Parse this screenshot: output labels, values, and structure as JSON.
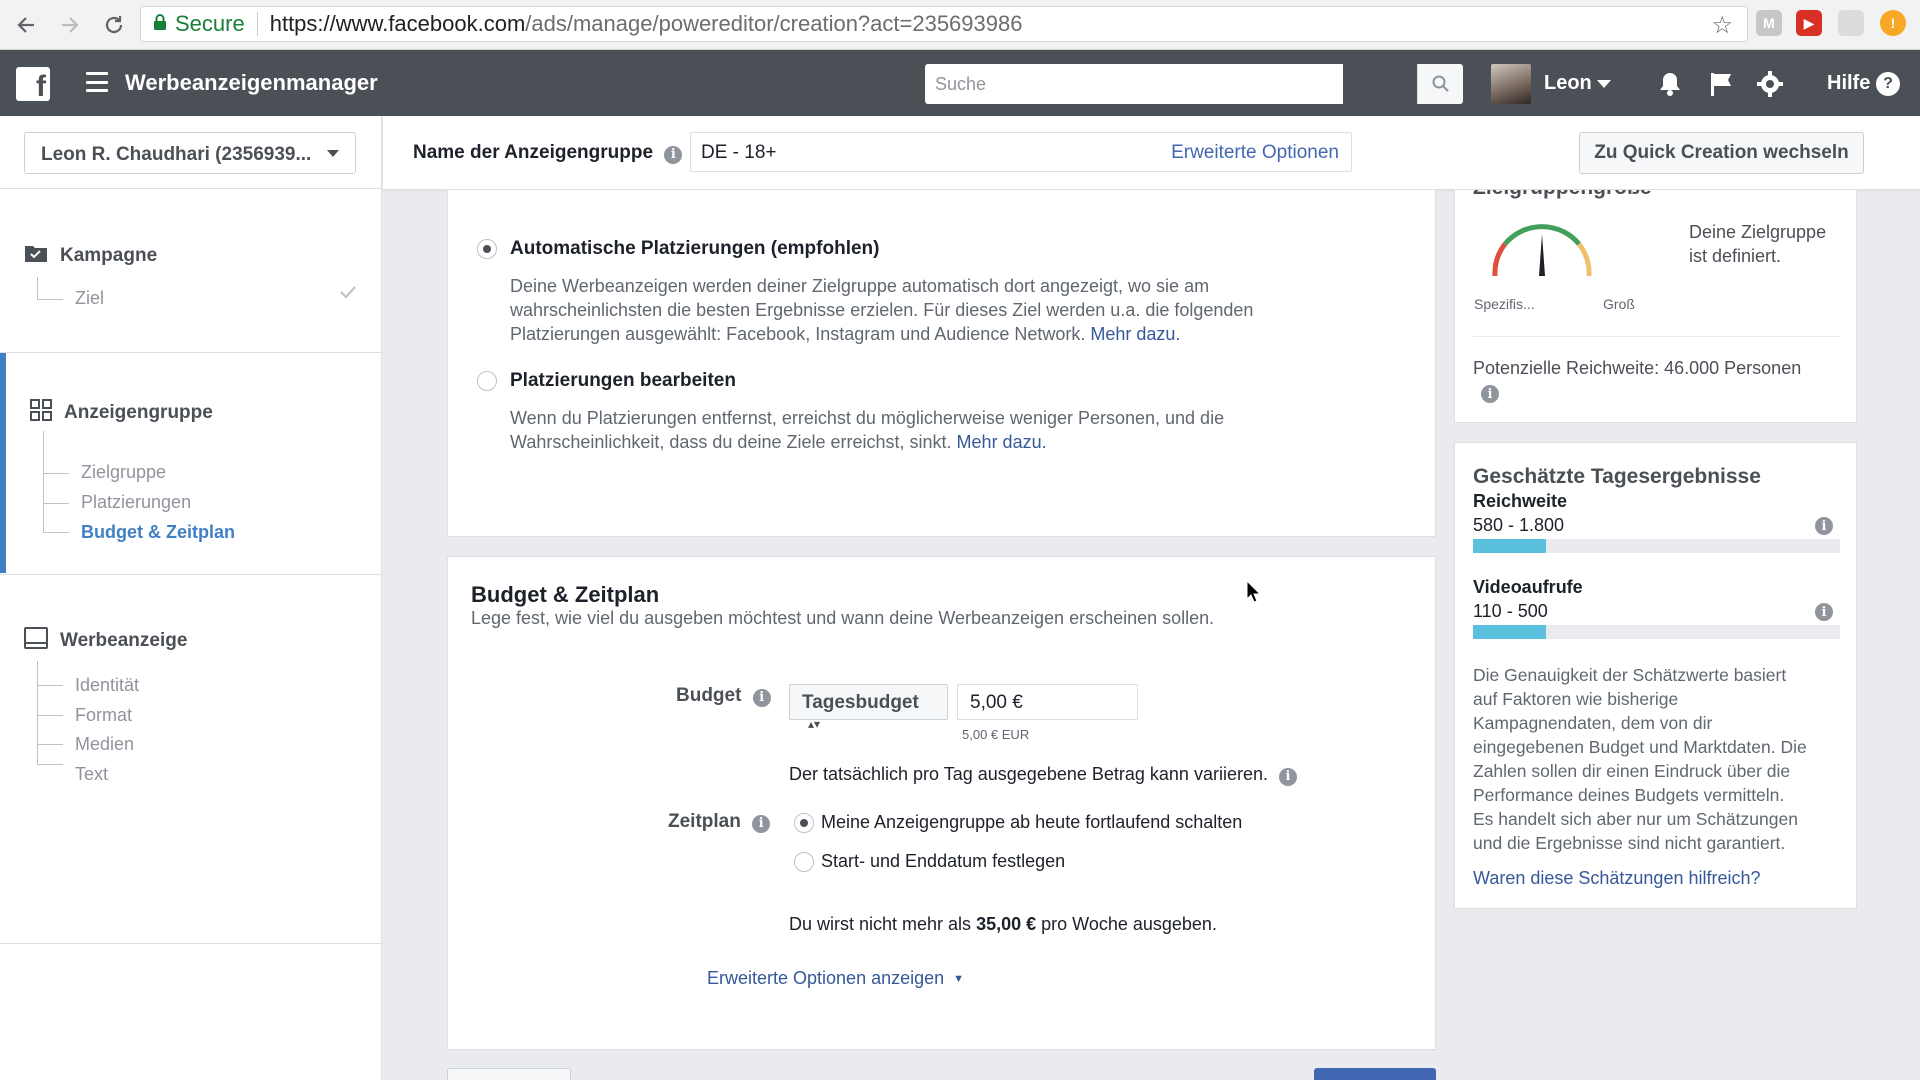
{
  "browser": {
    "secure_label": "Secure",
    "url_host": "https://www.facebook.com",
    "url_rest": "/ads/manage/powereditor/creation?act=235693986"
  },
  "topbar": {
    "app_title": "Werbeanzeigenmanager",
    "search_placeholder": "Suche",
    "user_name": "Leon",
    "help_label": "Hilfe"
  },
  "sidebar": {
    "account": "Leon R. Chaudhari (2356939...",
    "campaign": {
      "label": "Kampagne",
      "items": [
        "Ziel"
      ]
    },
    "adset": {
      "label": "Anzeigengruppe",
      "items": [
        "Zielgruppe",
        "Platzierungen",
        "Budget & Zeitplan"
      ]
    },
    "ad": {
      "label": "Werbeanzeige",
      "items": [
        "Identität",
        "Format",
        "Medien",
        "Text"
      ]
    }
  },
  "header": {
    "adset_name_label": "Name der Anzeigengruppe",
    "adset_name_value": "DE - 18+",
    "advanced_options": "Erweiterte Optionen",
    "quick_creation": "Zu Quick Creation wechseln"
  },
  "placements": {
    "auto": {
      "title": "Automatische Platzierungen (empfohlen)",
      "desc_1": "Deine Werbeanzeigen werden deiner Zielgruppe automatisch dort angezeigt, wo sie am",
      "desc_2": "wahrscheinlichsten die besten Ergebnisse erzielen. Für dieses Ziel werden u.a. die folgenden",
      "desc_3": "Platzierungen ausgewählt: Facebook, Instagram und Audience Network.",
      "more": "Mehr dazu."
    },
    "edit": {
      "title": "Platzierungen bearbeiten",
      "desc_1": "Wenn du Platzierungen entfernst, erreichst du möglicherweise weniger Personen, und die",
      "desc_2": "Wahrscheinlichkeit, dass du deine Ziele erreichst, sinkt.",
      "more": "Mehr dazu."
    }
  },
  "budget": {
    "title": "Budget & Zeitplan",
    "subtitle": "Lege fest, wie viel du ausgeben möchtest und wann deine Werbeanzeigen erscheinen sollen.",
    "budget_label": "Budget",
    "budget_type": "Tagesbudget",
    "amount": "5,00 €",
    "amount_eur": "5,00 € EUR",
    "variance_note": "Der tatsächlich pro Tag ausgegebene Betrag kann variieren.",
    "schedule_label": "Zeitplan",
    "schedule_option_1": "Meine Anzeigengruppe ab heute fortlaufend schalten",
    "schedule_option_2": "Start- und Enddatum festlegen",
    "weekly_prefix": "Du wirst nicht mehr als",
    "weekly_amount": "35,00 €",
    "weekly_suffix": "pro Woche ausgeben.",
    "advanced_link": "Erweiterte Optionen anzeigen"
  },
  "audience": {
    "title_partial": "Zielgruppengröße",
    "gauge_left": "Spezifis...",
    "gauge_right": "Groß",
    "defined_1": "Deine Zielgruppe",
    "defined_2": "ist definiert.",
    "reach": "Potenzielle Reichweite: 46.000 Personen"
  },
  "estimates": {
    "title": "Geschätzte Tagesergebnisse",
    "reach_label": "Reichweite",
    "reach_value": "580 - 1.800",
    "reach_fill": 0.2,
    "views_label": "Videoaufrufe",
    "views_value": "110 - 500",
    "views_fill": 0.2,
    "note_1": "Die Genauigkeit der Schätzwerte basiert",
    "note_2": "auf Faktoren wie bisherige",
    "note_3": "Kampagnendaten, dem von dir",
    "note_4": "eingegebenen Budget und Marktdaten. Die",
    "note_5": "Zahlen sollen dir einen Eindruck über die",
    "note_6": "Performance deines Budgets vermitteln.",
    "note_7": "Es handelt sich aber nur um Schätzungen",
    "note_8": "und die Ergebnisse sind nicht garantiert.",
    "helpful": "Waren diese Schätzungen hilfreich?"
  },
  "colors": {
    "topbar": "#4b4f56",
    "accent": "#4080c2",
    "link": "#365899",
    "estimate_bar": "#5bc0de"
  }
}
